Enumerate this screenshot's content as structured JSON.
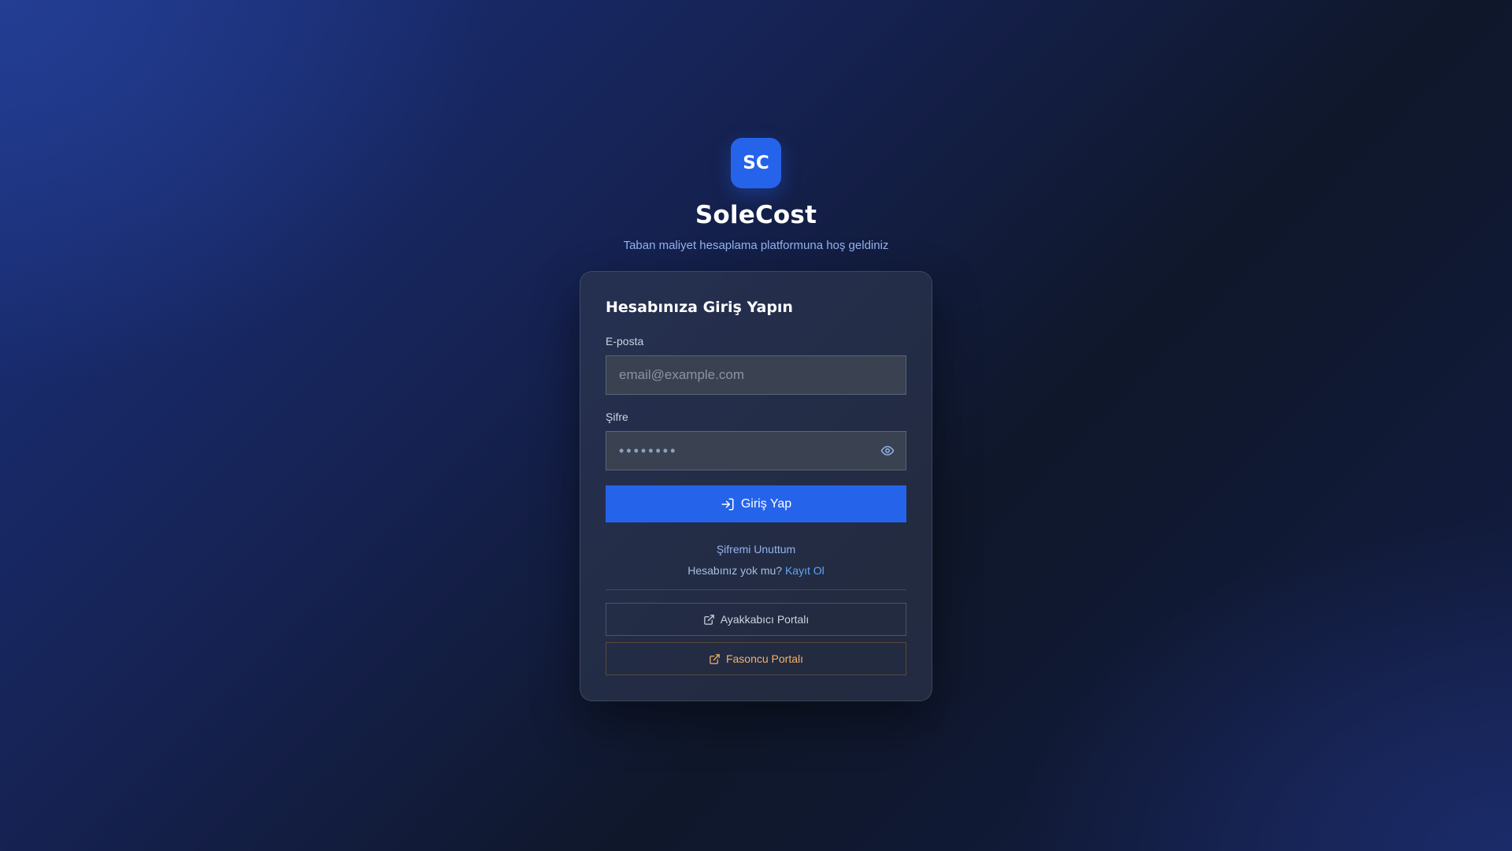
{
  "brand": {
    "logo_text": "SC",
    "app_name": "SoleCost",
    "tagline": "Taban maliyet hesaplama platformuna hoş geldiniz"
  },
  "login_card": {
    "title": "Hesabınıza Giriş Yapın",
    "email": {
      "label": "E-posta",
      "placeholder": "email@example.com",
      "value": ""
    },
    "password": {
      "label": "Şifre",
      "placeholder": "••••••••",
      "value": "",
      "toggle_icon": "eye-icon"
    },
    "submit": {
      "label": "Giriş Yap",
      "icon": "log-in-icon"
    },
    "forgot_password": "Şifremi Unuttum",
    "register_prompt": "Hesabınız yok mu?",
    "register_link": "Kayıt Ol",
    "portals": [
      {
        "label": "Ayakkabıcı Portalı",
        "icon": "external-link-icon",
        "color": "#cbd5e1"
      },
      {
        "label": "Fasoncu Portalı",
        "icon": "external-link-icon",
        "color": "#f5b26b"
      }
    ]
  },
  "colors": {
    "accent": "#2563eb",
    "link": "#60a5fa",
    "subcontractor_accent": "#f5b26b"
  }
}
